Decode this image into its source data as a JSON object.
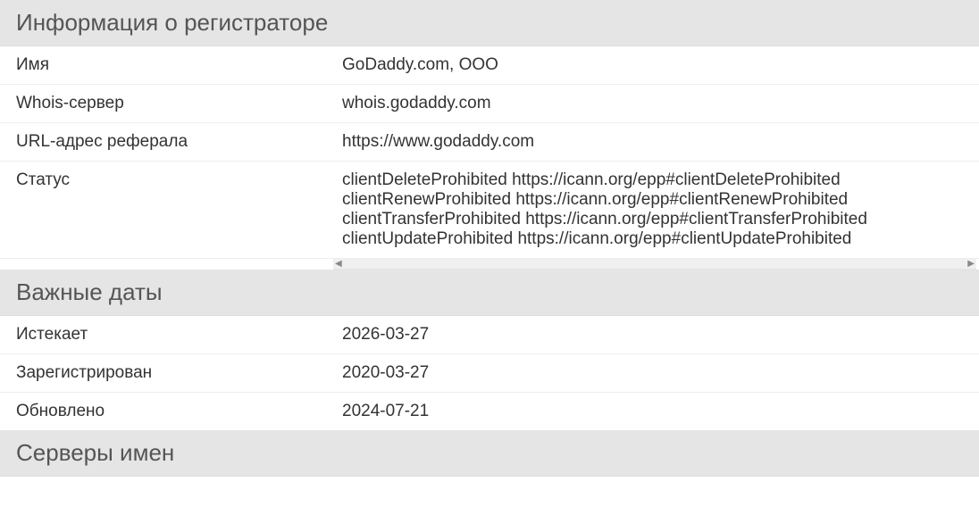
{
  "sections": {
    "registrar": {
      "title": "Информация о регистраторе",
      "name_label": "Имя",
      "name_value": "GoDaddy.com, ООО",
      "whois_label": "Whois-сервер",
      "whois_value": "whois.godaddy.com",
      "referral_label": "URL-адрес реферала",
      "referral_value": "https://www.godaddy.com",
      "status_label": "Статус",
      "status_line1": "clientDeleteProhibited https://icann.org/epp#clientDeleteProhibited",
      "status_line2": "clientRenewProhibited https://icann.org/epp#clientRenewProhibited",
      "status_line3": "clientTransferProhibited https://icann.org/epp#clientTransferProhibited",
      "status_line4": "clientUpdateProhibited https://icann.org/epp#clientUpdateProhibited"
    },
    "dates": {
      "title": "Важные даты",
      "expires_label": "Истекает",
      "expires_value": "2026-03-27",
      "registered_label": "Зарегистрирован",
      "registered_value": "2020-03-27",
      "updated_label": "Обновлено",
      "updated_value": "2024-07-21"
    },
    "nameservers": {
      "title": "Серверы имен"
    }
  }
}
